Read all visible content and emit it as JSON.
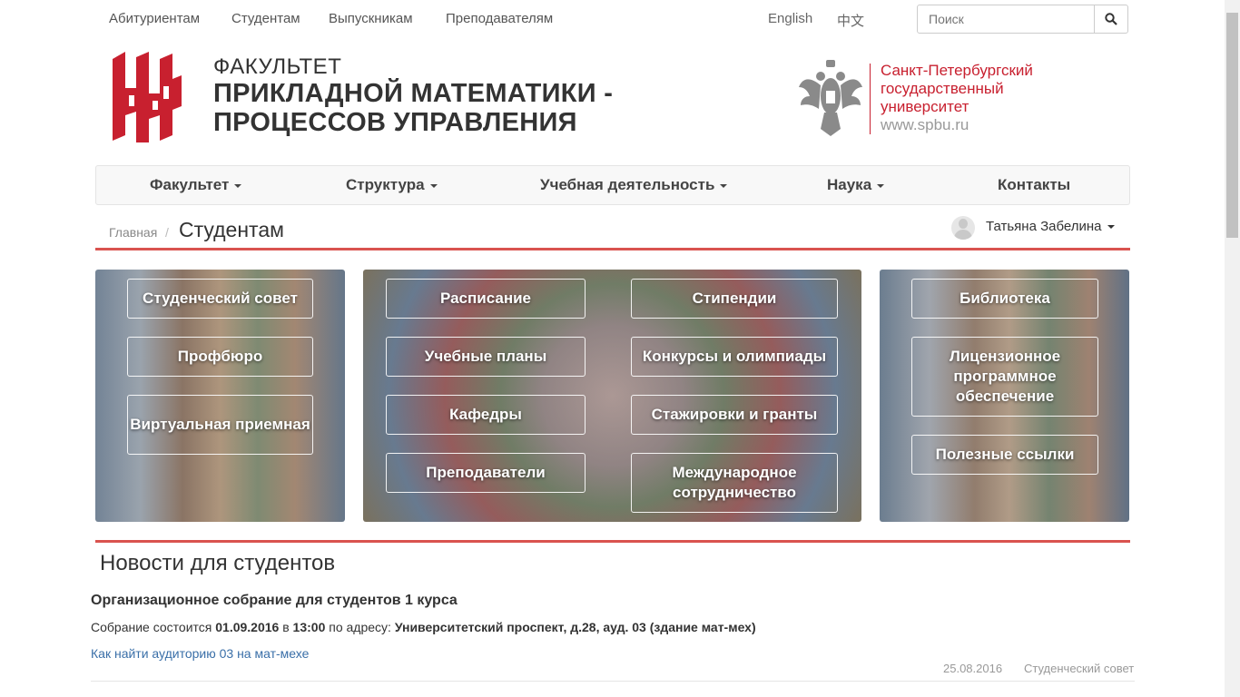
{
  "topnav": {
    "items": [
      "Абитуриентам",
      "Студентам",
      "Выпускникам",
      "Преподавателям"
    ]
  },
  "lang": {
    "english": "English",
    "chinese": "中文"
  },
  "search": {
    "placeholder": "Поиск"
  },
  "header": {
    "faculty_label": "ФАКУЛЬТЕТ",
    "faculty_line1": "ПРИКЛАДНОЙ МАТЕМАТИКИ -",
    "faculty_line2": "ПРОЦЕССОВ УПРАВЛЕНИЯ",
    "univ_line1": "Санкт-Петербургский",
    "univ_line2": "государственный",
    "univ_line3": "университет",
    "univ_url": "www.spbu.ru"
  },
  "mainnav": {
    "items": [
      {
        "label": "Факультет"
      },
      {
        "label": "Структура"
      },
      {
        "label": "Учебная деятельность"
      },
      {
        "label": "Наука"
      },
      {
        "label": "Контакты"
      }
    ]
  },
  "breadcrumb": {
    "home": "Главная",
    "separator": "/",
    "current": "Студентам"
  },
  "user": {
    "name": "Татьяна Забелина"
  },
  "panels": {
    "left": [
      "Студенческий совет",
      "Профбюро",
      "Виртуальная приемная"
    ],
    "middle": [
      "Расписание",
      "Стипендии",
      "Учебные планы",
      "Конкурсы и олимпиады",
      "Кафедры",
      "Стажировки и гранты",
      "Преподаватели",
      "Международное сотрудничество"
    ],
    "right": [
      "Библиотека",
      "Лицензионное программное обеспечение",
      "Полезные ссылки"
    ]
  },
  "news": {
    "section_title": "Новости для студентов",
    "item": {
      "title": "Организационное собрание для студентов 1 курса",
      "text_pre": "Собрание состоится ",
      "date_bold": "01.09.2016",
      "text_in": " в ",
      "time_bold": "13:00",
      "text_addr": " по адресу: ",
      "address_bold": "Университетский проспект, д.28, ауд. 03 (здание мат-мех)",
      "link": "Как найти аудиторию 03 на мат-мехе",
      "date": "25.08.2016",
      "category": "Студенческий совет"
    }
  },
  "colors": {
    "accent_red": "#c8202f",
    "link_blue": "#3a6fa8",
    "divider": "#d9534f"
  }
}
